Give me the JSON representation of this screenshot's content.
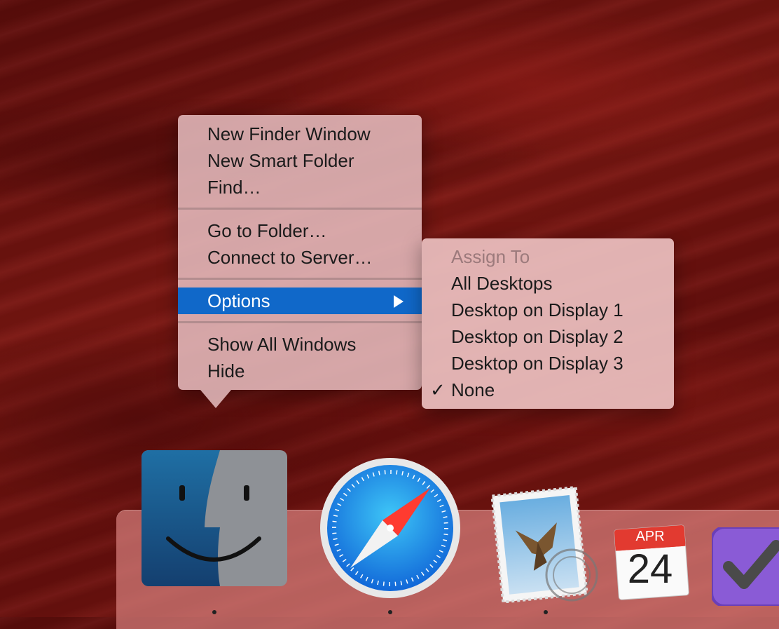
{
  "main_menu": {
    "items": [
      {
        "label": "New Finder Window"
      },
      {
        "label": "New Smart Folder"
      },
      {
        "label": "Find…"
      },
      {
        "label": "Go to Folder…"
      },
      {
        "label": "Connect to Server…"
      },
      {
        "label": "Options",
        "selected": true
      },
      {
        "label": "Show All Windows"
      },
      {
        "label": "Hide"
      }
    ]
  },
  "submenu": {
    "header": "Assign To",
    "items": [
      {
        "label": "All Desktops"
      },
      {
        "label": "Desktop on Display 1"
      },
      {
        "label": "Desktop on Display 2"
      },
      {
        "label": "Desktop on Display 3"
      },
      {
        "label": "None",
        "checked": true
      }
    ],
    "check_mark": "✓"
  },
  "dock": {
    "apps": [
      {
        "name": "finder-icon"
      },
      {
        "name": "safari-icon"
      },
      {
        "name": "mail-icon"
      },
      {
        "name": "calendar-icon",
        "month": "APR",
        "day": "24"
      },
      {
        "name": "omnifocus-icon"
      }
    ]
  },
  "colors": {
    "selection": "#1068c9",
    "menu_bg": "#e6bec0",
    "dock_bg": "#d67e7c"
  }
}
